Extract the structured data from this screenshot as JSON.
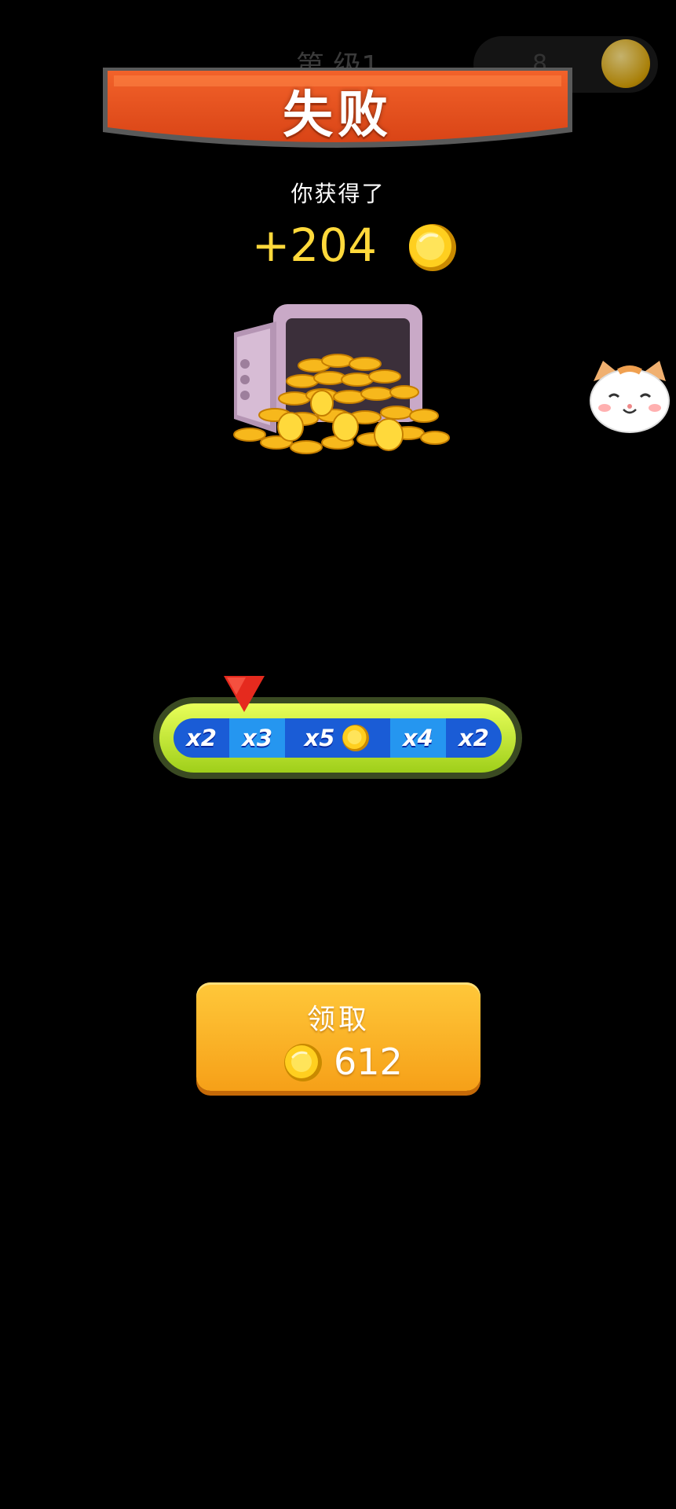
{
  "background": {
    "level_text": "第 级1",
    "coin_count": "8"
  },
  "banner": {
    "title": "失败"
  },
  "reward": {
    "label": "你获得了",
    "amount": "+204"
  },
  "multiplier": {
    "segments": [
      "x2",
      "x3",
      "x5",
      "x4",
      "x2"
    ],
    "selected_index": 1
  },
  "claim": {
    "label": "领取",
    "amount": "612"
  },
  "colors": {
    "banner": "#e8541e",
    "gold": "#ffd93b",
    "button": "#f8b52a",
    "bar_outline": "#c8ee2e",
    "pointer": "#e52a1e"
  },
  "icons": {
    "reward": "gold-coin-icon",
    "vault": "coin-vault",
    "mascot": "cat-face-icon",
    "pointer": "red-triangle-pointer"
  }
}
